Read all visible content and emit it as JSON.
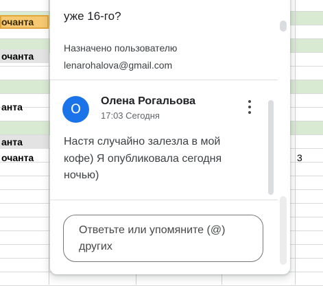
{
  "sheet": {
    "name_cells": [
      {
        "text": "очанта",
        "style": "orange"
      },
      {
        "text": "очанта",
        "style": "gray"
      },
      {
        "text": "анта",
        "style": "plain"
      },
      {
        "text": "анта",
        "style": "gray"
      },
      {
        "text": "очанта",
        "style": "plain"
      }
    ],
    "number_cell": "3"
  },
  "comment_card": {
    "previous_text": "уже 16-го?",
    "assigned_label": "Назначено пользователю",
    "assigned_email": "lenarohalova@gmail.com",
    "comment": {
      "avatar_letter": "О",
      "avatar_color": "#1a73e8",
      "author": "Олена Рогальова",
      "time": "17:03 Сегодня",
      "body": "Настя случайно залезла в мой кофе) Я опубликовала сегодня ночью)"
    },
    "reply": {
      "placeholder": "Ответьте или упомяните (@) других"
    }
  },
  "colors": {
    "green_row": "#d9ead3",
    "selected_cell": "#f6c871",
    "gray_cell": "#e3e3e3"
  }
}
